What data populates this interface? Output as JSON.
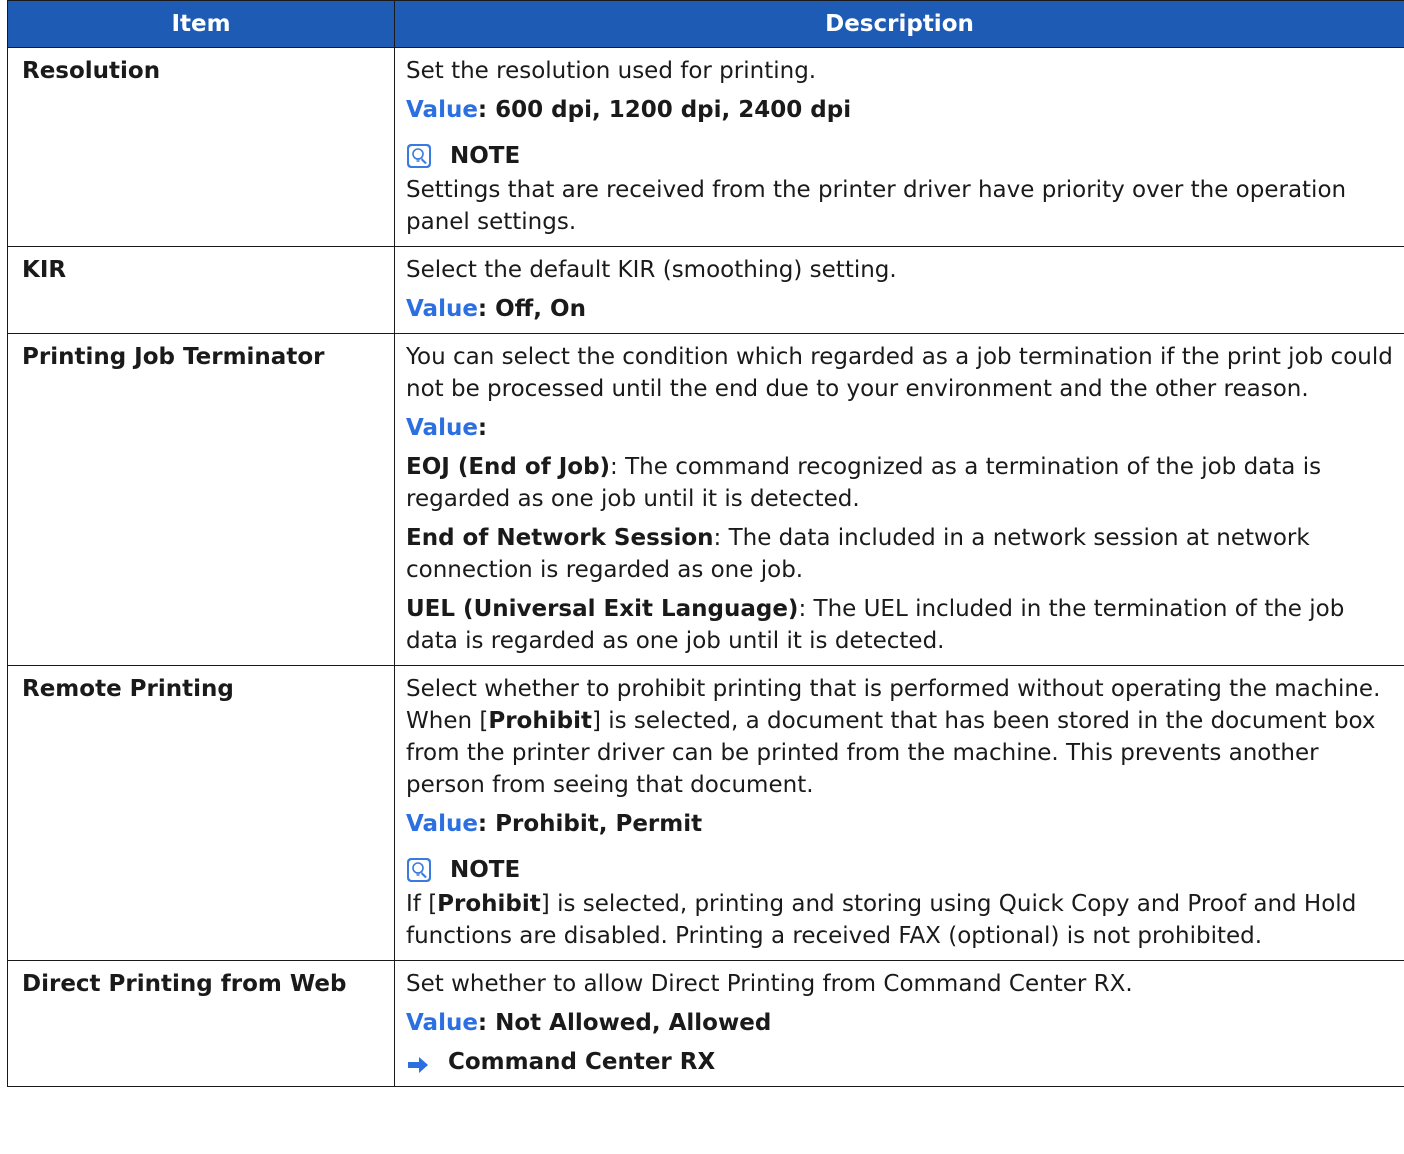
{
  "header": {
    "item": "Item",
    "description": "Description"
  },
  "rows": {
    "resolution": {
      "item": "Resolution",
      "text": "Set the resolution used for printing.",
      "value_label": "Value",
      "value_list": ": 600 dpi, 1200 dpi, 2400 dpi",
      "note_label": "NOTE",
      "note_text": "Settings that are received from the printer driver have priority over the operation panel settings."
    },
    "kir": {
      "item": "KIR",
      "text": "Select the default KIR (smoothing) setting.",
      "value_label": "Value",
      "value_list": ": Off, On"
    },
    "terminator": {
      "item": "Printing Job Terminator",
      "text": "You can select the condition which regarded as a job termination if the print job could not be processed until the end due to your environment and the other reason.",
      "value_label": "Value",
      "value_colon": ":",
      "opt1_term": "EOJ (End of Job)",
      "opt1_text": ": The command recognized as a termination of the job data is regarded as one job until it is detected.",
      "opt2_term": "End of Network Session",
      "opt2_text": ": The data included in a network session at network connection is regarded as one job.",
      "opt3_term": "UEL (Universal Exit Language)",
      "opt3_text": ": The UEL included in the termination of the job data is regarded as one job until it is detected."
    },
    "remote": {
      "item": "Remote Printing",
      "text_a": "Select whether to prohibit printing that is performed without operating the machine. When [",
      "text_b": "Prohibit",
      "text_c": "] is selected, a document that has been stored in the document box from the printer driver can be printed from the machine. This prevents another person from seeing that document.",
      "value_label": "Value",
      "value_list": ": Prohibit, Permit",
      "note_label": "NOTE",
      "note_a": "If [",
      "note_b": "Prohibit",
      "note_c": "] is selected, printing and storing using Quick Copy and Proof and Hold functions are disabled. Printing a received FAX (optional) is not prohibited."
    },
    "direct": {
      "item": "Direct Printing from Web",
      "text": "Set whether to allow Direct Printing from Command Center RX.",
      "value_label": "Value",
      "value_list": ": Not Allowed, Allowed",
      "ref": "Command Center RX"
    }
  },
  "colors": {
    "header_bg": "#1e5bb4",
    "value_label": "#2b6fe0",
    "border": "#1a1a1a"
  },
  "icons": {
    "note": "note-lightbulb-icon",
    "ref": "right-arrow-icon"
  }
}
